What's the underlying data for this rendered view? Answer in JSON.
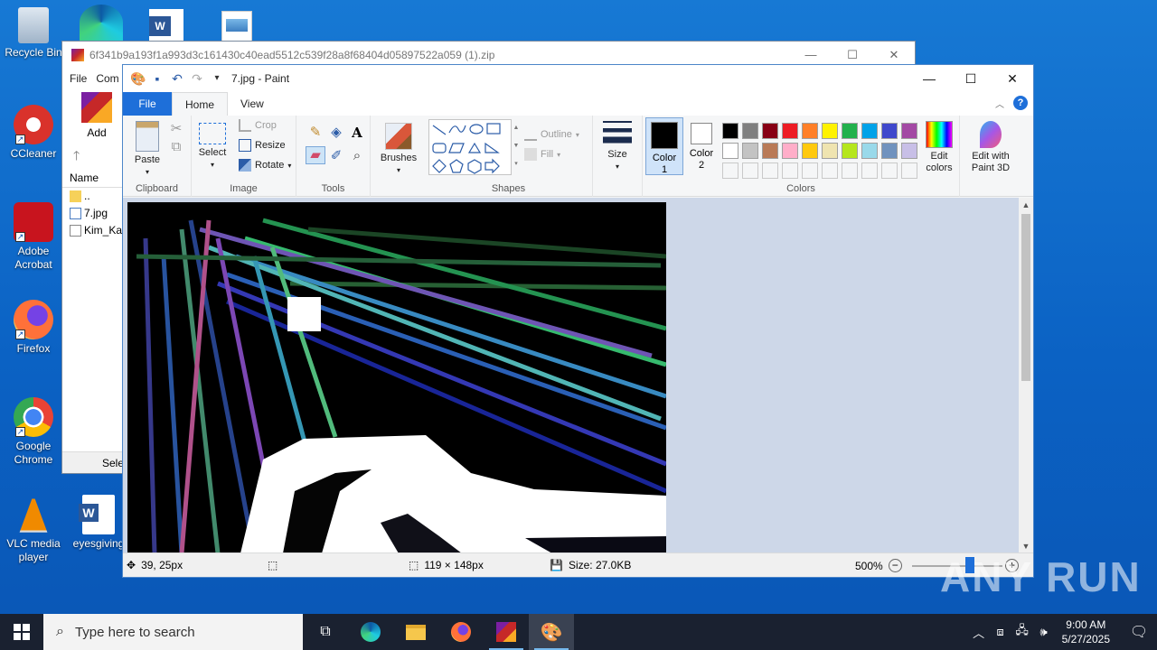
{
  "desktop": {
    "icons": [
      {
        "label": "Recycle Bin",
        "icon": "recycle-bin-icon"
      },
      {
        "label": "CCleaner",
        "icon": "ccleaner-icon"
      },
      {
        "label": "Adobe Acrobat",
        "icon": "acrobat-icon"
      },
      {
        "label": "Firefox",
        "icon": "firefox-icon"
      },
      {
        "label": "Google Chrome",
        "icon": "chrome-icon"
      },
      {
        "label": "VLC media player",
        "icon": "vlc-icon"
      },
      {
        "label": "eyesgiving",
        "icon": "word-doc-icon"
      }
    ]
  },
  "winrar": {
    "title": "6f341b9a193f1a993d3c161430c40ead5512c539f28a8f68404d05897522a059 (1).zip",
    "menu": [
      "File",
      "Com"
    ],
    "add_label": "Add",
    "list_header": "Name",
    "rows": [
      "..",
      "7.jpg",
      "Kim_Ka"
    ],
    "status": "Sele"
  },
  "paint": {
    "title": "7.jpg - Paint",
    "tabs": {
      "file": "File",
      "home": "Home",
      "view": "View"
    },
    "clipboard": {
      "paste": "Paste",
      "group": "Clipboard"
    },
    "image": {
      "select": "Select",
      "crop": "Crop",
      "resize": "Resize",
      "rotate": "Rotate",
      "group": "Image"
    },
    "tools": {
      "group": "Tools"
    },
    "brushes": {
      "label": "Brushes"
    },
    "shapes": {
      "outline": "Outline",
      "fill": "Fill",
      "group": "Shapes"
    },
    "size": {
      "label": "Size"
    },
    "colors": {
      "color1": "Color 1",
      "color2": "Color 2",
      "edit": "Edit colors",
      "group": "Colors",
      "palette_row1": [
        "#000000",
        "#7f7f7f",
        "#880015",
        "#ed1c24",
        "#ff7f27",
        "#fff200",
        "#22b14c",
        "#00a2e8",
        "#3f48cc",
        "#a349a4"
      ],
      "palette_row2": [
        "#ffffff",
        "#c3c3c3",
        "#b97a57",
        "#ffaec9",
        "#ffc90e",
        "#efe4b0",
        "#b5e61d",
        "#99d9ea",
        "#7092be",
        "#c8bfe7"
      ]
    },
    "paint3d": {
      "label": "Edit with Paint 3D"
    },
    "status": {
      "cursor_pos": "39, 25px",
      "selection_size": "119 × 148px",
      "file_size": "Size: 27.0KB",
      "zoom": "500%"
    }
  },
  "taskbar": {
    "search_placeholder": "Type here to search",
    "time": "9:00 AM",
    "date": "5/27/2025"
  },
  "watermark": "ANY RUN"
}
